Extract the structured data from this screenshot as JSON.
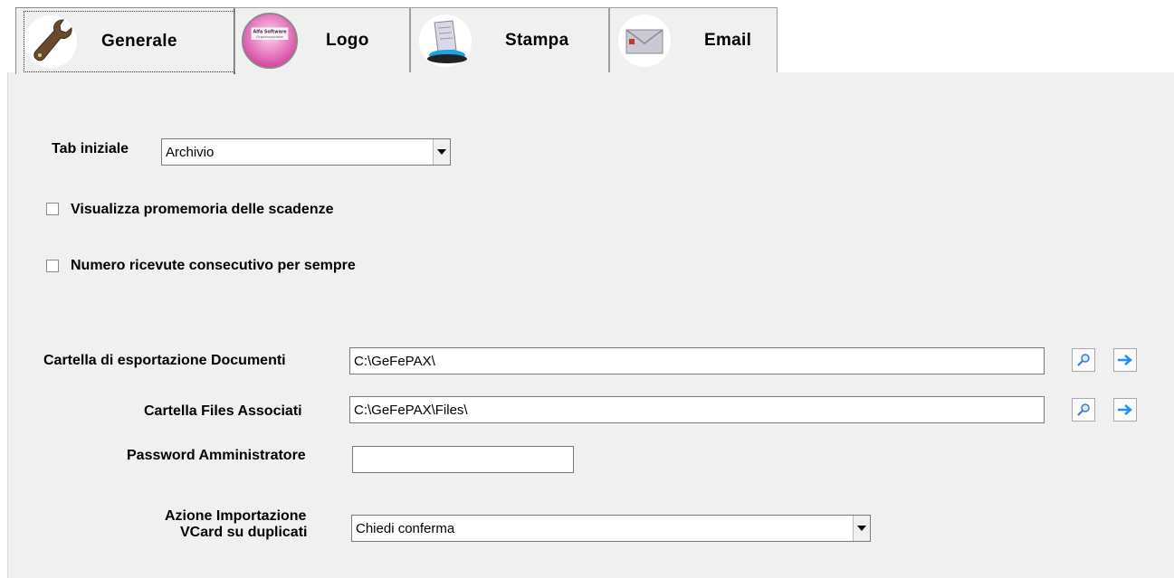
{
  "tabs": [
    {
      "label": "Generale",
      "icon": "wrench-icon"
    },
    {
      "label": "Logo",
      "icon": "logo-disc-icon"
    },
    {
      "label": "Stampa",
      "icon": "printer-icon"
    },
    {
      "label": "Email",
      "icon": "envelope-icon"
    }
  ],
  "active_tab": "Generale",
  "form": {
    "tab_iniziale": {
      "label": "Tab iniziale",
      "value": "Archivio"
    },
    "promemoria": {
      "label": "Visualizza promemoria delle scadenze",
      "checked": false
    },
    "ricevute": {
      "label": "Numero ricevute consecutivo per sempre",
      "checked": false
    },
    "cartella_documenti": {
      "label": "Cartella di esportazione Documenti",
      "value": "C:\\GeFePAX\\"
    },
    "cartella_files": {
      "label": "Cartella Files Associati",
      "value": "C:\\GeFePAX\\Files\\"
    },
    "password": {
      "label": "Password Amministratore",
      "value": ""
    },
    "azione_vcard": {
      "label_line1": "Azione Importazione",
      "label_line2": "VCard su duplicati",
      "value": "Chiedi conferma"
    }
  },
  "logo_icon_text": [
    "Alfa Software",
    "Organizzazione"
  ],
  "colors": {
    "panel": "#f0f0f0",
    "arrow_blue": "#1e90ff"
  }
}
